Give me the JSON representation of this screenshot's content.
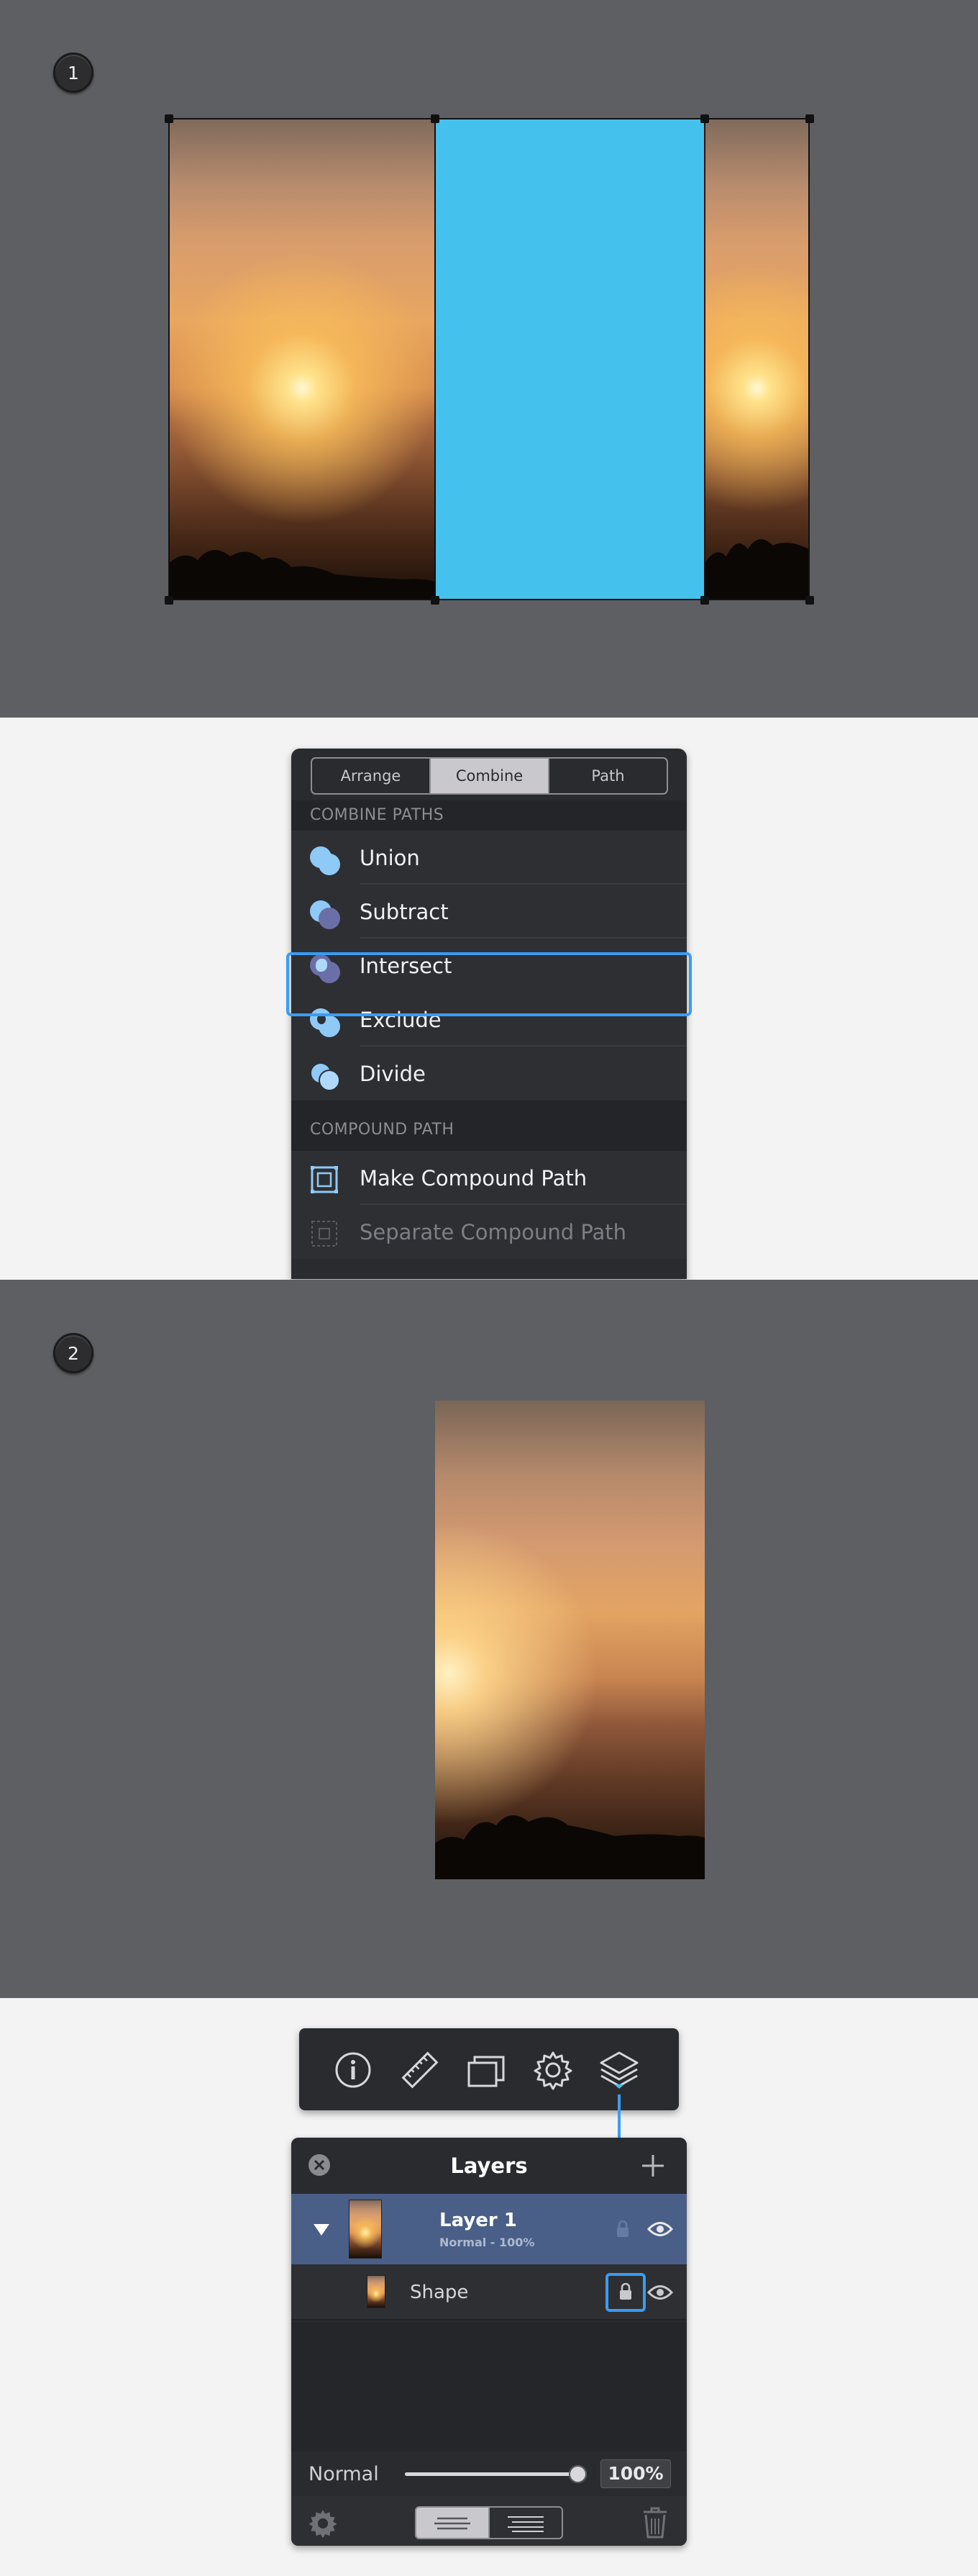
{
  "steps": {
    "one": "1",
    "two": "2"
  },
  "colors": {
    "canvas": "#5e5f62",
    "accent": "#45c1ee",
    "selection": "#3a9cf2",
    "layer_row": "#4a5f87"
  },
  "combine_panel": {
    "tabs": [
      {
        "label": "Arrange"
      },
      {
        "label": "Combine",
        "selected": true
      },
      {
        "label": "Path"
      }
    ],
    "sections": [
      {
        "heading": "COMBINE PATHS",
        "items": [
          {
            "label": "Union",
            "icon": "union-icon"
          },
          {
            "label": "Subtract",
            "icon": "subtract-icon"
          },
          {
            "label": "Intersect",
            "icon": "intersect-icon",
            "highlighted": true
          },
          {
            "label": "Exclude",
            "icon": "exclude-icon"
          },
          {
            "label": "Divide",
            "icon": "divide-icon"
          }
        ]
      },
      {
        "heading": "COMPOUND PATH",
        "items": [
          {
            "label": "Make Compound Path",
            "icon": "make-compound-path-icon"
          },
          {
            "label": "Separate Compound Path",
            "icon": "separate-compound-path-icon",
            "disabled": true
          }
        ]
      }
    ]
  },
  "toolbar": {
    "icons": [
      "info-icon",
      "ruler-icon",
      "duplicate-icon",
      "gear-icon",
      "layers-icon"
    ],
    "active": "layers-icon"
  },
  "layers_panel": {
    "title": "Layers",
    "layers": [
      {
        "name": "Layer 1",
        "subtitle": "Normal - 100%",
        "expanded": true,
        "selected": true
      }
    ],
    "children": [
      {
        "name": "Shape",
        "locked": true
      }
    ],
    "blend_mode": "Normal",
    "opacity": "100%",
    "opacity_value": 1.0
  }
}
